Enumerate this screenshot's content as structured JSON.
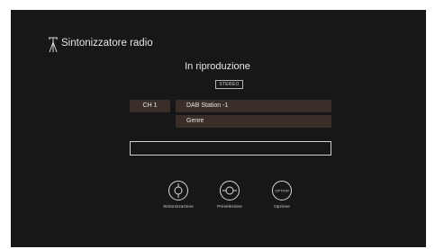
{
  "header": {
    "title": "Sintonizzatore radio",
    "icon": "antenna-icon"
  },
  "status": {
    "now_playing": "In riproduzione",
    "stereo_badge": "STEREO"
  },
  "station": {
    "channel": "CH 1",
    "name": "DAB Station -1",
    "genre": "Genre",
    "radio_text": ""
  },
  "controls": [
    {
      "label": "Sintonizzazione",
      "icon": "tuning-dial-icon"
    },
    {
      "label": "Preselezione",
      "icon": "preset-icon"
    },
    {
      "label": "Opzione",
      "icon": "option-icon",
      "icon_text": "OPTION"
    }
  ],
  "colors": {
    "background": "#171717",
    "row_fill": "#3a2f28",
    "text": "#e6e6e6"
  }
}
